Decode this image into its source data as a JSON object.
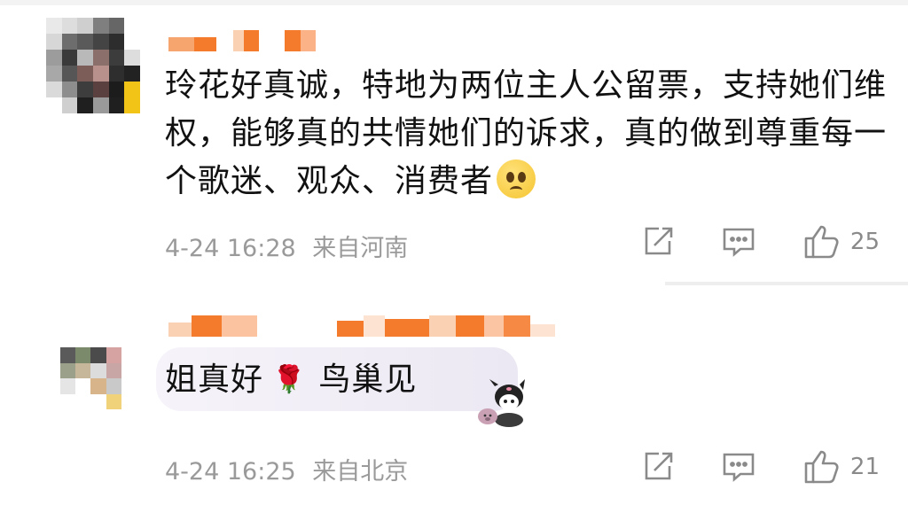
{
  "comments": [
    {
      "nickname_blurred": true,
      "text": "玲花好真诚，特地为两位主人公留票，支持她们维权，能够真的共情她们的诉求，真的做到尊重每一个歌迷、观众、消费者",
      "emoji": "pleading-face",
      "timestamp": "4-24 16:28",
      "location": "来自河南",
      "likes": "25"
    },
    {
      "nickname_blurred": true,
      "text_before": "姐真好",
      "emoji": "rose",
      "text_after": "鸟巢见",
      "sticker": "kuromi-sticker",
      "timestamp": "4-24 16:25",
      "location": "来自北京",
      "likes": "21"
    }
  ],
  "icons": {
    "share": "share-icon",
    "reply": "comment-icon",
    "like": "thumbs-up-icon",
    "rose": "🌹"
  },
  "colors": {
    "nickname_blur": "#f47a2c",
    "meta_text": "#9a9a9a",
    "body_text": "#111111"
  }
}
